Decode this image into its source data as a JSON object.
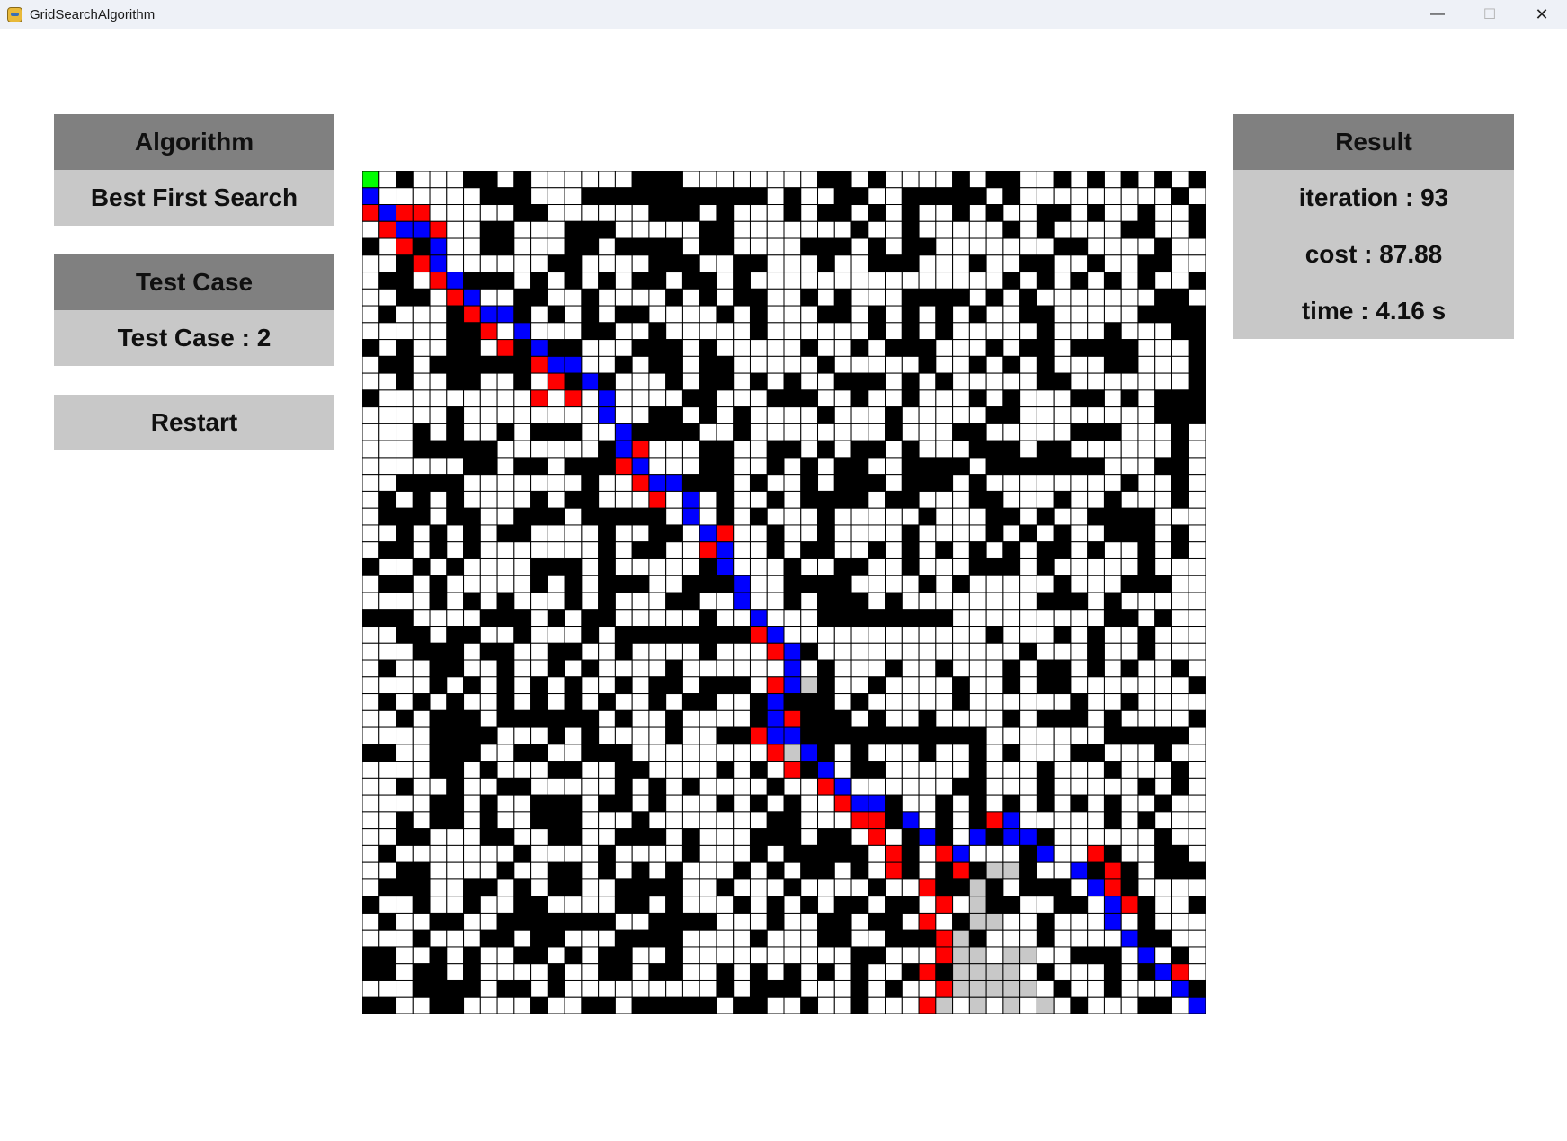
{
  "window": {
    "title": "GridSearchAlgorithm"
  },
  "algorithm": {
    "header": "Algorithm",
    "value": "Best First Search"
  },
  "test_case": {
    "header": "Test Case",
    "value": "Test Case : 2"
  },
  "restart": {
    "label": "Restart"
  },
  "result": {
    "header": "Result",
    "iteration": "iteration : 93",
    "cost": "cost : 87.88",
    "time": "time : 4.16 s"
  },
  "grid": {
    "rows": 50,
    "cols": 50,
    "colors": {
      "empty": "#ffffff",
      "wall": "#000000",
      "path": "#0000ff",
      "frontier": "#ff0000",
      "visited": "#c8c8c8",
      "start": "#00ff00",
      "line": "#000000"
    },
    "start": [
      0,
      0
    ],
    "goal": [
      49,
      49
    ],
    "path_cells": [
      [
        1,
        0
      ],
      [
        2,
        1
      ],
      [
        3,
        2
      ],
      [
        3,
        3
      ],
      [
        4,
        4
      ],
      [
        5,
        4
      ],
      [
        6,
        5
      ],
      [
        7,
        6
      ],
      [
        8,
        7
      ],
      [
        8,
        8
      ],
      [
        9,
        9
      ],
      [
        10,
        10
      ],
      [
        11,
        11
      ],
      [
        11,
        12
      ],
      [
        12,
        13
      ],
      [
        13,
        14
      ],
      [
        14,
        14
      ],
      [
        15,
        15
      ],
      [
        16,
        15
      ],
      [
        17,
        16
      ],
      [
        18,
        17
      ],
      [
        18,
        18
      ],
      [
        19,
        19
      ],
      [
        20,
        19
      ],
      [
        21,
        20
      ],
      [
        22,
        21
      ],
      [
        23,
        21
      ],
      [
        24,
        22
      ],
      [
        25,
        22
      ],
      [
        26,
        23
      ],
      [
        27,
        24
      ],
      [
        28,
        25
      ],
      [
        29,
        25
      ],
      [
        30,
        25
      ],
      [
        31,
        24
      ],
      [
        32,
        24
      ],
      [
        33,
        24
      ],
      [
        33,
        25
      ],
      [
        34,
        26
      ],
      [
        35,
        27
      ],
      [
        36,
        28
      ],
      [
        37,
        29
      ],
      [
        37,
        30
      ],
      [
        38,
        32
      ],
      [
        39,
        33
      ],
      [
        40,
        35
      ],
      [
        39,
        36
      ],
      [
        39,
        38
      ],
      [
        38,
        38
      ],
      [
        39,
        39
      ],
      [
        40,
        40
      ],
      [
        41,
        42
      ],
      [
        42,
        43
      ],
      [
        43,
        44
      ],
      [
        44,
        44
      ],
      [
        45,
        45
      ],
      [
        46,
        46
      ],
      [
        47,
        47
      ],
      [
        48,
        48
      ],
      [
        49,
        49
      ]
    ],
    "frontier_cells": [
      [
        2,
        0
      ],
      [
        3,
        1
      ],
      [
        2,
        2
      ],
      [
        2,
        3
      ],
      [
        3,
        4
      ],
      [
        4,
        2
      ],
      [
        5,
        3
      ],
      [
        6,
        4
      ],
      [
        7,
        5
      ],
      [
        8,
        6
      ],
      [
        9,
        7
      ],
      [
        10,
        8
      ],
      [
        11,
        10
      ],
      [
        12,
        11
      ],
      [
        13,
        10
      ],
      [
        13,
        12
      ],
      [
        16,
        16
      ],
      [
        17,
        15
      ],
      [
        18,
        16
      ],
      [
        19,
        17
      ],
      [
        21,
        21
      ],
      [
        22,
        20
      ],
      [
        25,
        22
      ],
      [
        27,
        23
      ],
      [
        28,
        24
      ],
      [
        30,
        24
      ],
      [
        32,
        25
      ],
      [
        33,
        23
      ],
      [
        34,
        24
      ],
      [
        35,
        25
      ],
      [
        36,
        27
      ],
      [
        37,
        28
      ],
      [
        38,
        29
      ],
      [
        38,
        30
      ],
      [
        39,
        30
      ],
      [
        40,
        31
      ],
      [
        41,
        31
      ],
      [
        42,
        33
      ],
      [
        43,
        34
      ],
      [
        44,
        33
      ],
      [
        45,
        34
      ],
      [
        46,
        34
      ],
      [
        47,
        33
      ],
      [
        48,
        34
      ],
      [
        49,
        33
      ],
      [
        40,
        34
      ],
      [
        41,
        35
      ],
      [
        38,
        37
      ],
      [
        39,
        38
      ],
      [
        40,
        43
      ],
      [
        41,
        44
      ],
      [
        42,
        44
      ],
      [
        43,
        45
      ],
      [
        47,
        48
      ]
    ],
    "visited_cells": [
      [
        30,
        26
      ],
      [
        32,
        25
      ],
      [
        34,
        25
      ],
      [
        41,
        37
      ],
      [
        41,
        38
      ],
      [
        42,
        36
      ],
      [
        43,
        36
      ],
      [
        44,
        36
      ],
      [
        44,
        37
      ],
      [
        45,
        35
      ],
      [
        46,
        35
      ],
      [
        46,
        36
      ],
      [
        47,
        35
      ],
      [
        47,
        36
      ],
      [
        47,
        37
      ],
      [
        47,
        38
      ],
      [
        48,
        35
      ],
      [
        48,
        36
      ],
      [
        48,
        37
      ],
      [
        48,
        38
      ],
      [
        48,
        39
      ],
      [
        49,
        34
      ],
      [
        49,
        36
      ],
      [
        49,
        38
      ],
      [
        49,
        40
      ],
      [
        46,
        38
      ],
      [
        46,
        39
      ]
    ],
    "wall_density": 0.4,
    "seed": 2
  }
}
